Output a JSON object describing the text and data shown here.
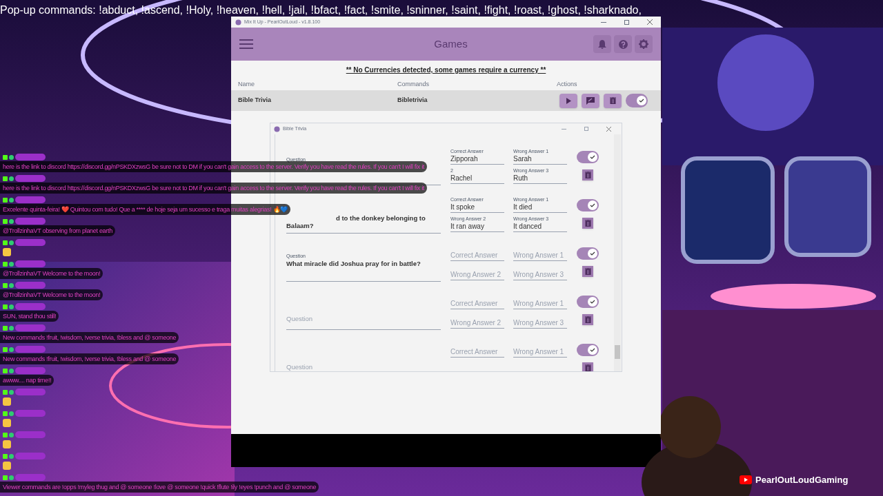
{
  "ticker": "Pop-up commands: !abduct, !ascend, !Holy, !heaven, !hell,  !jail, !bfact, !fact, !smite, !sninner, !saint, !fight, !roast, !ghost, !sharknado,",
  "app": {
    "title": "Mix It Up - PearlOutLoud - v1.8.100",
    "header": "Games",
    "notice": "** No Currencies detected, some games require a currency **",
    "columns": [
      "Name",
      "Commands",
      "Actions"
    ],
    "games": [
      {
        "name": "Bible Trivia",
        "command": "Bibletrivia",
        "enabled": true
      }
    ]
  },
  "dialog": {
    "title": "Bible Trivia",
    "rows": [
      {
        "question": {
          "label": "Question"
        },
        "fields": [
          {
            "label": "Correct Answer",
            "value": "Zipporah"
          },
          {
            "label": "Wrong Answer 1",
            "value": "Sarah"
          },
          {
            "label": "2",
            "value": "Rachel"
          },
          {
            "label": "Wrong Answer 3",
            "value": "Ruth"
          }
        ],
        "enabled": true
      },
      {
        "question": {
          "value": "d to the donkey belonging to Balaam?"
        },
        "fields": [
          {
            "label": "Correct Answer",
            "value": "It spoke"
          },
          {
            "label": "Wrong Answer 1",
            "value": "It died"
          },
          {
            "label": "Wrong Answer 2",
            "value": "It ran away"
          },
          {
            "label": "Wrong Answer 3",
            "value": "It danced"
          }
        ],
        "enabled": true
      },
      {
        "question": {
          "label": "Question",
          "value": "What miracle did Joshua pray for in battle?"
        },
        "fields": [
          {
            "placeholder": "Correct Answer"
          },
          {
            "placeholder": "Wrong Answer 1"
          },
          {
            "placeholder": "Wrong Answer 2"
          },
          {
            "placeholder": "Wrong Answer 3"
          }
        ],
        "enabled": true
      },
      {
        "question": {
          "placeholder": "Question"
        },
        "fields": [
          {
            "placeholder": "Correct Answer"
          },
          {
            "placeholder": "Wrong Answer 1"
          },
          {
            "placeholder": "Wrong Answer 2"
          },
          {
            "placeholder": "Wrong Answer 3"
          }
        ],
        "enabled": true
      },
      {
        "question": {
          "placeholder": "Question"
        },
        "fields": [
          {
            "placeholder": "Correct Answer"
          },
          {
            "placeholder": "Wrong Answer 1"
          }
        ],
        "enabled": true
      }
    ]
  },
  "chat": [
    {
      "kind": "text",
      "text": "here is the link to discord https://discord.gg/nPSKDXzwsG be sure not to DM if you can't gain access to the server. Verify you have read the rules. If you can't I will fix it"
    },
    {
      "kind": "text",
      "text": "here is the link to discord https://discord.gg/nPSKDXzwsG be sure not to DM if you can't gain access to the server. Verify you have read the rules. If you can't I will fix it"
    },
    {
      "kind": "text",
      "text": "Excelente quinta-feira! ❤️ Quintou com tudo! Que a **** de hoje seja um sucesso e traga muitas alegrias! 🔥💙"
    },
    {
      "kind": "text",
      "text": "@TrollzinhaVT observing from planet earth"
    },
    {
      "kind": "emote"
    },
    {
      "kind": "text",
      "text": "@TrollzinhaVT Welcome to the moon!"
    },
    {
      "kind": "text",
      "text": "@TrollzinhaVT Welcome to the moon!"
    },
    {
      "kind": "text",
      "text": "SUN, stand thou still!"
    },
    {
      "kind": "text",
      "text": "New commands !fruit, !wisdom, !verse trivia, !bless and @ someone"
    },
    {
      "kind": "text",
      "text": "New commands !fruit, !wisdom, !verse trivia, !bless and @ someone"
    },
    {
      "kind": "text",
      "text": "awww.... nap time!!"
    },
    {
      "kind": "emote"
    },
    {
      "kind": "emote"
    },
    {
      "kind": "emote"
    },
    {
      "kind": "emote"
    },
    {
      "kind": "text",
      "text": "Viewer commands are !opps !myleg thug and @ someone !love @ someone !quick !flute !ily !eyes !punch and @ someone"
    }
  ],
  "channel": "PearlOutLoudGaming"
}
